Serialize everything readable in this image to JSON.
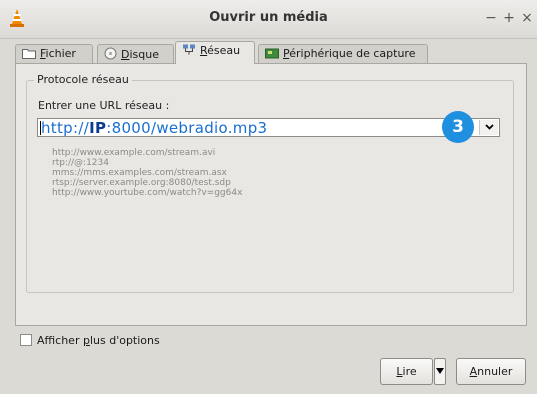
{
  "window": {
    "title": "Ouvrir un média",
    "minimize": "−",
    "maximize": "+",
    "close": "×"
  },
  "tabs": [
    {
      "pre": "",
      "u": "F",
      "post": "ichier",
      "icon": "folder-icon"
    },
    {
      "pre": "",
      "u": "D",
      "post": "isque",
      "icon": "disc-icon"
    },
    {
      "pre": "",
      "u": "R",
      "post": "éseau",
      "icon": "network-icon",
      "active": true
    },
    {
      "pre": "",
      "u": "P",
      "post": "ériphérique de capture",
      "icon": "capture-card-icon"
    }
  ],
  "group": {
    "title": "Protocole réseau",
    "url_label": "Entrer une URL réseau :",
    "url_parts": {
      "prefix": "http://",
      "bold": "IP",
      "suffix": ":8000/webradio.mp3"
    },
    "badge": "3",
    "examples": [
      "http://www.example.com/stream.avi",
      "rtp://@:1234",
      "mms://mms.examples.com/stream.asx",
      "rtsp://server.example.org:8080/test.sdp",
      "http://www.yourtube.com/watch?v=gg64x"
    ]
  },
  "options": {
    "pre": "Afficher ",
    "u": "p",
    "post": "lus d'options",
    "checked": false
  },
  "buttons": {
    "play": {
      "u": "L",
      "post": "ire"
    },
    "cancel": {
      "u": "A",
      "post": "nnuler"
    }
  },
  "colors": {
    "accent": "#1f8fe0",
    "url_text": "#1a6fd0"
  }
}
